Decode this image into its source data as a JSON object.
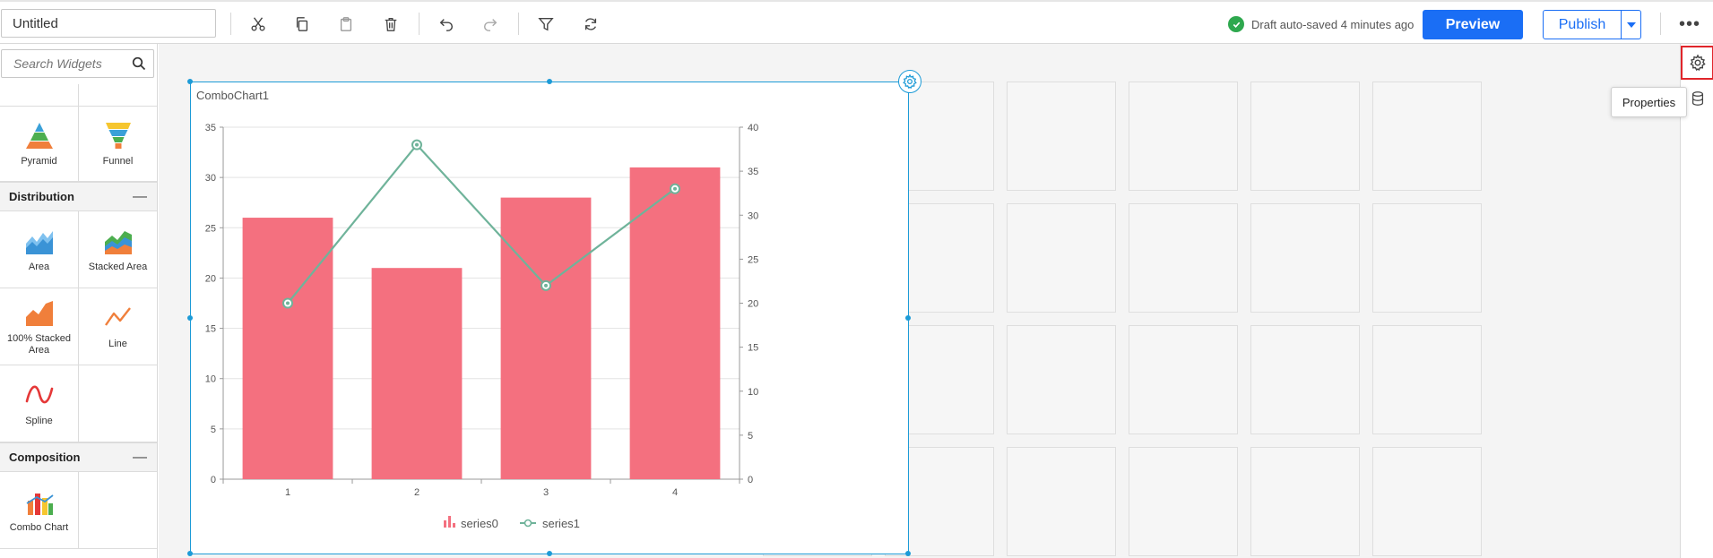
{
  "toolbar": {
    "title_value": "Untitled",
    "save_status": "Draft auto-saved 4 minutes ago",
    "preview_label": "Preview",
    "publish_label": "Publish",
    "more_label": "•••"
  },
  "sidebar": {
    "search_placeholder": "Search Widgets",
    "rows": [
      {
        "left": "",
        "right": ""
      },
      {
        "left": "Pyramid",
        "right": "Funnel"
      }
    ],
    "groups": [
      {
        "name": "Distribution",
        "collapse": "—",
        "items": [
          {
            "label": "Area",
            "icon": "area-chart-icon"
          },
          {
            "label": "Stacked Area",
            "icon": "stacked-area-chart-icon"
          },
          {
            "label": "100% Stacked Area",
            "icon": "stacked-area-100-icon"
          },
          {
            "label": "Line",
            "icon": "line-chart-icon"
          },
          {
            "label": "Spline",
            "icon": "spline-chart-icon"
          }
        ]
      },
      {
        "name": "Composition",
        "collapse": "—",
        "items": [
          {
            "label": "Combo Chart",
            "icon": "combo-chart-icon"
          }
        ]
      }
    ]
  },
  "widget": {
    "title": "ComboChart1"
  },
  "chart_data": {
    "type": "bar",
    "categories": [
      "1",
      "2",
      "3",
      "4"
    ],
    "series": [
      {
        "name": "series0",
        "type": "bar",
        "axis": "left",
        "values": [
          26,
          21,
          28,
          31
        ],
        "color": "#f4707f"
      },
      {
        "name": "series1",
        "type": "line",
        "axis": "right",
        "values": [
          20,
          38,
          22,
          33
        ],
        "color": "#6fb39a"
      }
    ],
    "y_left": {
      "min": 0,
      "max": 35,
      "step": 5
    },
    "y_right": {
      "min": 0,
      "max": 40,
      "step": 5
    },
    "grid": true,
    "legend": "bottom-center"
  },
  "right_rail": {
    "tooltip": "Properties"
  },
  "colors": {
    "accent": "#1a6ef5",
    "selection": "#1d9bd7",
    "success": "#2ea84e",
    "highlight": "#e0252b"
  }
}
